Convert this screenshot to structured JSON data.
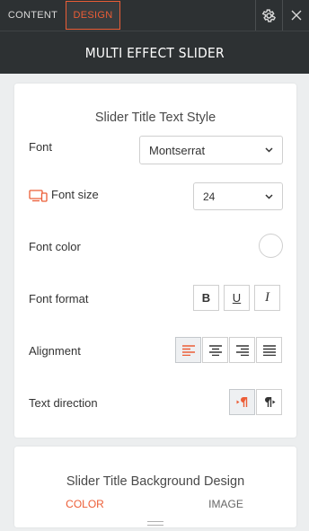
{
  "tabs": {
    "content": "CONTENT",
    "design": "DESIGN"
  },
  "panel_title": "MULTI EFFECT SLIDER",
  "text_style": {
    "section_title": "Slider Title Text Style",
    "font": {
      "label": "Font",
      "value": "Montserrat"
    },
    "font_size": {
      "label": "Font size",
      "value": "24"
    },
    "font_color": {
      "label": "Font color"
    },
    "font_format": {
      "label": "Font format",
      "bold": "B",
      "underline": "U",
      "italic": "I"
    },
    "alignment": {
      "label": "Alignment"
    },
    "text_direction": {
      "label": "Text direction"
    }
  },
  "background_design": {
    "section_title": "Slider Title Background Design",
    "tabs": {
      "color": "COLOR",
      "image": "IMAGE"
    }
  },
  "colors": {
    "accent": "#ec5d36",
    "dark_bar": "#2d3133"
  },
  "icons": [
    "gear-icon",
    "close-icon",
    "chevron-down-icon",
    "responsive-devices-icon",
    "align-left-icon",
    "align-center-icon",
    "align-right-icon",
    "align-justify-icon",
    "rtl-icon",
    "ltr-icon"
  ]
}
